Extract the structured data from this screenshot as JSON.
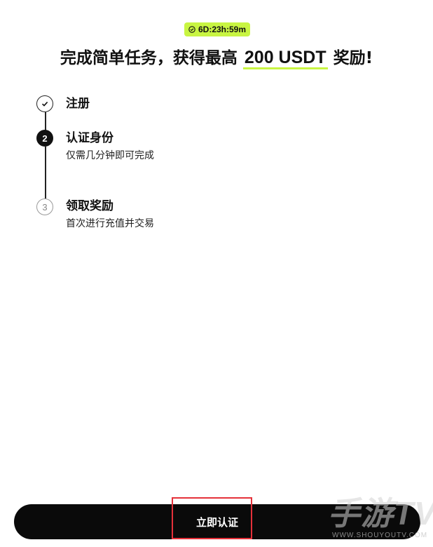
{
  "timer": {
    "icon": "clock-icon",
    "text": "6D:23h:59m"
  },
  "headline": {
    "prefix": "完成简单任务，获得最高 ",
    "amount": "200 USDT",
    "suffix": " 奖励!"
  },
  "steps": [
    {
      "number": "",
      "icon": "checkmark-icon",
      "state": "done",
      "title": "注册",
      "description": ""
    },
    {
      "number": "2",
      "state": "active",
      "title": "认证身份",
      "description": "仅需几分钟即可完成"
    },
    {
      "number": "3",
      "state": "pending",
      "title": "领取奖励",
      "description": "首次进行充值并交易"
    }
  ],
  "cta": {
    "label": "立即认证"
  },
  "watermark": {
    "brand": "手游TV",
    "url": "WWW.SHOUYOUTV.COM"
  },
  "colors": {
    "accent": "#c8f542",
    "button_bg": "#0a0a0a",
    "highlight": "#e5313a"
  }
}
